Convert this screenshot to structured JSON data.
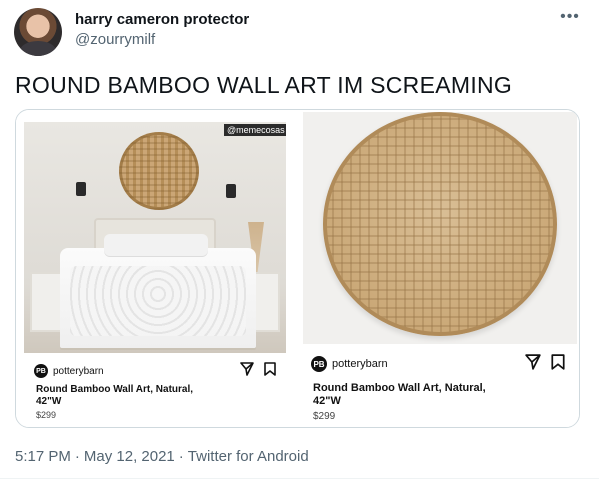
{
  "author": {
    "display_name": "harry cameron protector",
    "handle": "@zourrymilf"
  },
  "more_icon": "more-horizontal-icon",
  "tweet": {
    "text": "ROUND BAMBOO WALL ART IM SCREAMING"
  },
  "media": {
    "left": {
      "watermark": "@memecosas",
      "brand": {
        "logo_text": "PB",
        "name": "potterybarn"
      },
      "product_title": "Round Bamboo Wall Art, Natural, 42\"W",
      "price": "$299"
    },
    "right": {
      "brand": {
        "logo_text": "PB",
        "name": "potterybarn"
      },
      "product_title": "Round Bamboo Wall Art, Natural, 42\"W",
      "price": "$299"
    }
  },
  "meta": {
    "time": "5:17 PM",
    "separator": "·",
    "date": "May 12, 2021",
    "source": "Twitter for Android"
  }
}
